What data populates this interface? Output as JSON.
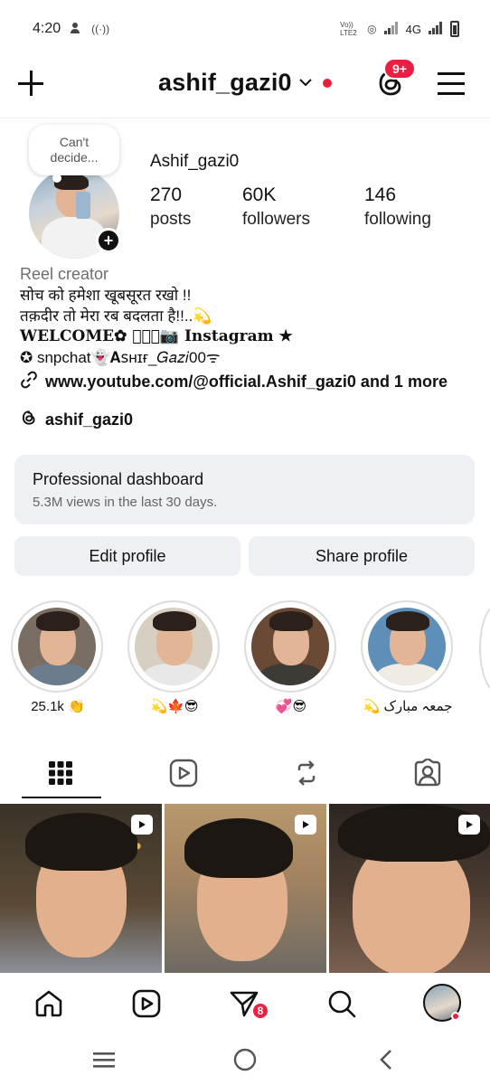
{
  "status_bar": {
    "time": "4:20",
    "network": "4G",
    "volte": "Vo)) LTE2"
  },
  "header": {
    "username": "ashif_gazi0",
    "notification_badge": "9+"
  },
  "profile": {
    "note": "Can't decide...",
    "display_name": "Ashif_gazi0",
    "stats": [
      {
        "value": "270",
        "label": "posts"
      },
      {
        "value": "60K",
        "label": "followers"
      },
      {
        "value": "146",
        "label": "following"
      }
    ],
    "bio": {
      "category": "Reel creator",
      "line1": "सोच को हमेशा खूबसूरत रखो !!",
      "line2": "तक़दीर तो मेरा रब बदलता है!!..💫",
      "line3": "𝐖𝐄𝐋𝐂𝐎𝐌𝐄✿ ⃝⸙͎📷 𝐈𝐧𝐬𝐭𝐚𝐠𝐫𝐚𝐦 ★",
      "line4": "✪ snpchat👻𝐀ꜱʜɪғ_𝐺𝑎𝑧𝑖00ᯤ"
    },
    "link": "www.youtube.com/@official.Ashif_gazi0 and 1 more",
    "threads_handle": "ashif_gazi0"
  },
  "dashboard": {
    "title": "Professional dashboard",
    "subtitle": "5.3M views in the last 30 days."
  },
  "buttons": {
    "edit": "Edit profile",
    "share": "Share profile"
  },
  "highlights": [
    {
      "label": "25.1k 👏"
    },
    {
      "label": "💫🍁😎"
    },
    {
      "label": "💞😎"
    },
    {
      "label": "💫 جمعہ مبارک"
    }
  ],
  "tabs": [
    "grid-tab",
    "reels-tab",
    "reposts-tab",
    "tagged-tab"
  ],
  "bottom_nav": {
    "activity_badge": "8"
  },
  "colors": {
    "accent_red": "#ee1d42",
    "card_bg": "#eff0f4",
    "muted_text": "#6e6e6e"
  }
}
